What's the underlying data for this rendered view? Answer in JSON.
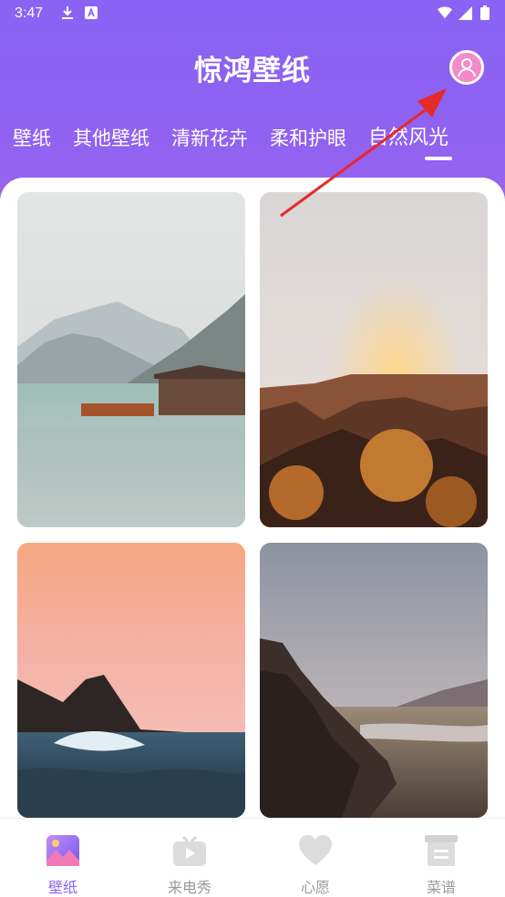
{
  "status_bar": {
    "time": "3:47",
    "icons_left": [
      "download-icon",
      "a-icon"
    ],
    "icons_right": [
      "wifi-icon",
      "signal-icon",
      "battery-icon"
    ]
  },
  "header": {
    "title": "惊鸿壁纸",
    "avatar_icon": "user-avatar-icon"
  },
  "tabs": [
    {
      "label": "壁纸"
    },
    {
      "label": "其他壁纸"
    },
    {
      "label": "清新花卉"
    },
    {
      "label": "柔和护眼"
    },
    {
      "label": "自然风光",
      "active": true
    }
  ],
  "wallpapers": [
    {
      "name": "lake-cabin-mountains"
    },
    {
      "name": "canyon-sunset"
    },
    {
      "name": "pink-sky-waves"
    },
    {
      "name": "rocky-beach-dusk"
    }
  ],
  "bottom_nav": [
    {
      "label": "壁纸",
      "icon": "image-icon",
      "active": true
    },
    {
      "label": "来电秀",
      "icon": "tv-play-icon"
    },
    {
      "label": "心愿",
      "icon": "heart-icon"
    },
    {
      "label": "菜谱",
      "icon": "recipe-box-icon"
    }
  ],
  "colors": {
    "accent": "#8a63f4",
    "avatar_bg": "#f489c8",
    "arrow": "#e52a2a",
    "inactive": "#9a9a9a"
  }
}
